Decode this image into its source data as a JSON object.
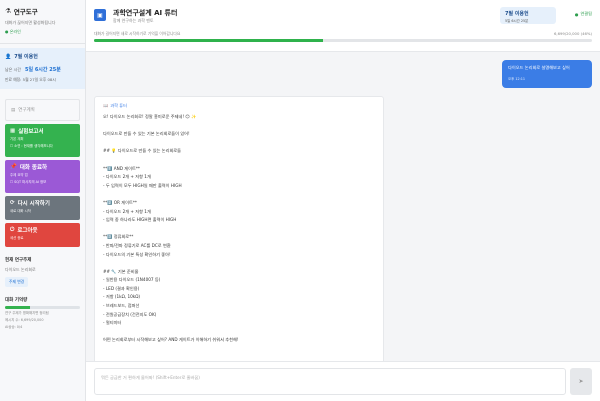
{
  "sidebar": {
    "app_title": "연구도구",
    "app_sub": "대화가 끊어지면 활성화됩니다",
    "status": "● 온라인",
    "user": {
      "name": "7필 이용헌",
      "time_label": "남은 시간",
      "time_value": "5일 6시간 25분",
      "expire": "만료 예정: 5월 27일 오후 08시"
    },
    "record_label": "연구계획",
    "buttons": [
      {
        "title": "실험보고서",
        "sub": "기본 계획",
        "sub2": "☐ 소연 : 현재를 생각해보니다"
      },
      {
        "title": "대화 종료하",
        "sub": "주제 요약 업",
        "sub2": "☐ SQT 마사지의 AI 정보"
      },
      {
        "title": "다시 시작하기",
        "sub": "새로 대화 시작"
      },
      {
        "title": "로그아웃",
        "sub": "세션 종료"
      }
    ],
    "topic_head": "현재 연구주제",
    "topic_value": "다이오드 논리회로",
    "topic_chip": "주제 변경",
    "memory_head": "대화 기억량",
    "memory_sub1": "연구 주제가 명확해지면 정리됩",
    "memory_sub2": "메시지 수: 6,699/20,000",
    "memory_sub3": "AI상승: 0/4",
    "memory_fill": 0.33
  },
  "header": {
    "title": "과학연구설계 AI 튜터",
    "subtitle": "함께 연구하는 과학 멘토",
    "user_name": "7필 이용헌",
    "user_time": "5일 6시간 25분",
    "connection": "연결됨",
    "hint": "대화가 길어지면 새로 시작하기로 기억을 이어갑니다요",
    "count": "6,699/20,000 (46%)",
    "progress": 0.46
  },
  "chat": {
    "user_message": "다이오드 논리회로 설명해보고 싶어",
    "user_time": "오후 12:11",
    "bot_label": "과학 튜터",
    "bot_lines": [
      "오! 다이오드 논리회로! 정말 흥미로운 주제네! 😊 ✨",
      "",
      "다이오드로 만들 수 있는 기본 논리회로들이 있어!",
      "",
      "## 💡 다이오드로 만들 수 있는 논리회로들",
      "",
      "**1️⃣ AND 게이트**",
      "- 다이오드 2개 + 저항 1개",
      "- 두 입력이 모두 HIGH일 때만 출력이 HIGH",
      "",
      "**2️⃣ OR 게이트**",
      "- 다이오드 2개 + 저항 1개",
      "- 입력 중 하나라도 HIGH면 출력이 HIGH",
      "",
      "**3️⃣ 정류회로**",
      "- 반파/전파 정류기로 AC를 DC로 변환",
      "- 다이오드의 기본 특성 확인하기 좋아!",
      "",
      "## 🔧 기본 준비물",
      "- 일반용 다이오드 (1N4007 등)",
      "- LED (결과 확인용)",
      "- 저항 (1kΩ, 10kΩ)",
      "- 브레드보드, 점퍼선",
      "- 전원공급장치 (건전지도 OK)",
      "- 멀티미터",
      "",
      "어떤 논리회로부터 시작해보고 싶어? AND 게이트가 이해하기 쉬워서 추천해!"
    ]
  },
  "composer": {
    "placeholder": "뭐든 궁금한 거 편하게 물어봐! (Shift+Enter로 줄바꿈)",
    "send_icon": "send-icon"
  },
  "colors": {
    "accent": "#3b7de6",
    "green": "#34b24f",
    "purple": "#9b59d6",
    "gray": "#6c757d",
    "red": "#e0463f"
  }
}
